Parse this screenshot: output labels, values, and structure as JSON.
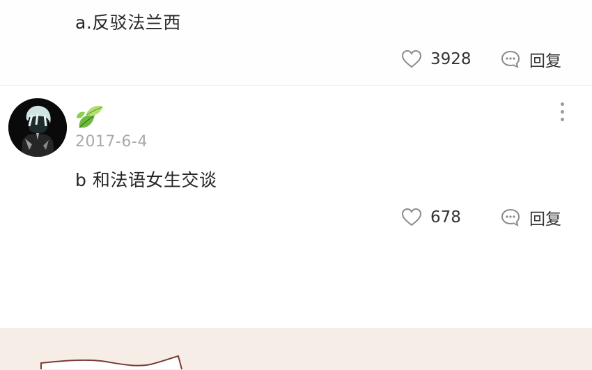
{
  "comments": [
    {
      "text": "a.反驳法兰西",
      "likes": "3928",
      "reply_label": "回复"
    },
    {
      "date": "2017-6-4",
      "text": "b 和法语女生交谈",
      "likes": "678",
      "reply_label": "回复",
      "badge_icon": "leaf-badge-icon",
      "avatar_icon": "anime-avatar"
    }
  ],
  "colors": {
    "background": "#ffffff",
    "bottom_panel": "#f6eee6",
    "date_gray": "#a9a9a9"
  }
}
